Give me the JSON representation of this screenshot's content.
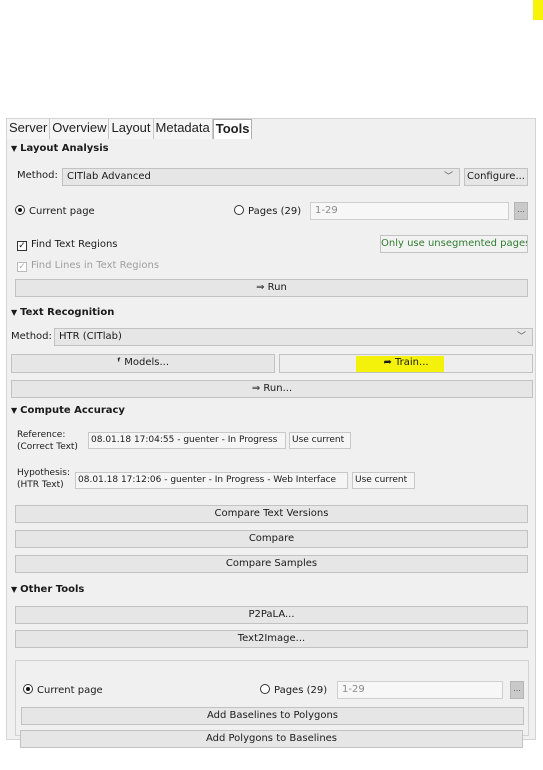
{
  "tabs": [
    "Server",
    "Overview",
    "Layout",
    "Metadata",
    "Tools"
  ],
  "layout_analysis": {
    "header": "Layout Analysis",
    "method_label": "Method:",
    "method_value": "CITlab Advanced",
    "configure_button": "Configure...",
    "current_page_label": "Current page",
    "pages_label": "Pages (29)",
    "pages_value": "1-29",
    "more_button": "...",
    "find_text_regions": "Find Text Regions",
    "find_lines": "Find Lines in Text Regions",
    "only_unsegmented": "Only use unsegmented pages",
    "run_button": "⇒ Run"
  },
  "text_recognition": {
    "header": "Text Recognition",
    "method_label": "Method:",
    "method_value": "HTR (CITlab)",
    "models_button": "Models...",
    "train_button": "Train...",
    "run_button": "⇒ Run..."
  },
  "compute_accuracy": {
    "header": "Compute Accuracy",
    "reference_label_1": "Reference:",
    "reference_label_2": "(Correct Text)",
    "reference_value": "08.01.18 17:04:55 - guenter - In Progress",
    "use_current_1": "Use current",
    "hypothesis_label_1": "Hypothesis:",
    "hypothesis_label_2": "(HTR Text)",
    "hypothesis_value": "08.01.18 17:12:06 - guenter - In Progress - Web Interface",
    "use_current_2": "Use current",
    "compare_text_versions": "Compare Text Versions",
    "compare": "Compare",
    "compare_samples": "Compare Samples"
  },
  "other_tools": {
    "header": "Other Tools",
    "p2pala": "P2PaLA...",
    "text2image": "Text2Image...",
    "current_page_label": "Current page",
    "pages_label": "Pages (29)",
    "pages_value": "1-29",
    "more_button": "...",
    "add_baselines": "Add Baselines to Polygons",
    "add_polygons": "Add Polygons to Baselines"
  },
  "icons": {
    "collapse": "triangle-down-icon",
    "chevron": "chevron-down-icon",
    "models": "models-icon",
    "train": "train-arrow-icon"
  },
  "colors": {
    "highlight": "#f4f20a",
    "green_text": "#2f7d2f",
    "panel_bg": "#f0f0f0"
  }
}
